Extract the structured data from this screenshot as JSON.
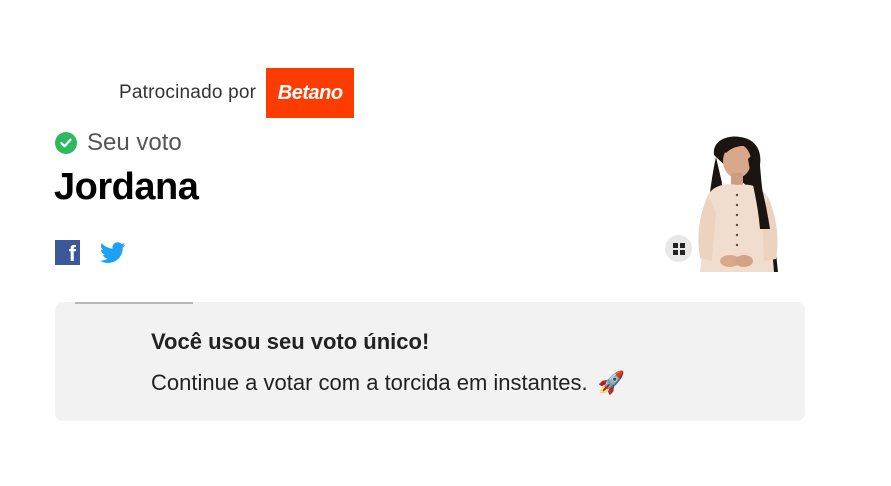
{
  "sponsor": {
    "label": "Patrocinado por",
    "brand": "Betano",
    "brand_color": "#ff3c00"
  },
  "vote": {
    "status_label": "Seu voto",
    "candidate": "Jordana",
    "check_icon": "check-circle-icon",
    "check_color": "#2eb860"
  },
  "share": {
    "facebook_icon": "facebook-icon",
    "twitter_icon": "twitter-icon",
    "facebook_color": "#3b5998",
    "twitter_color": "#1da1f2"
  },
  "photo": {
    "expand_icon": "expand-icon"
  },
  "notice": {
    "title": "Você usou seu voto único!",
    "text": "Continue a votar com a torcida em instantes.",
    "emoji": "🚀"
  }
}
